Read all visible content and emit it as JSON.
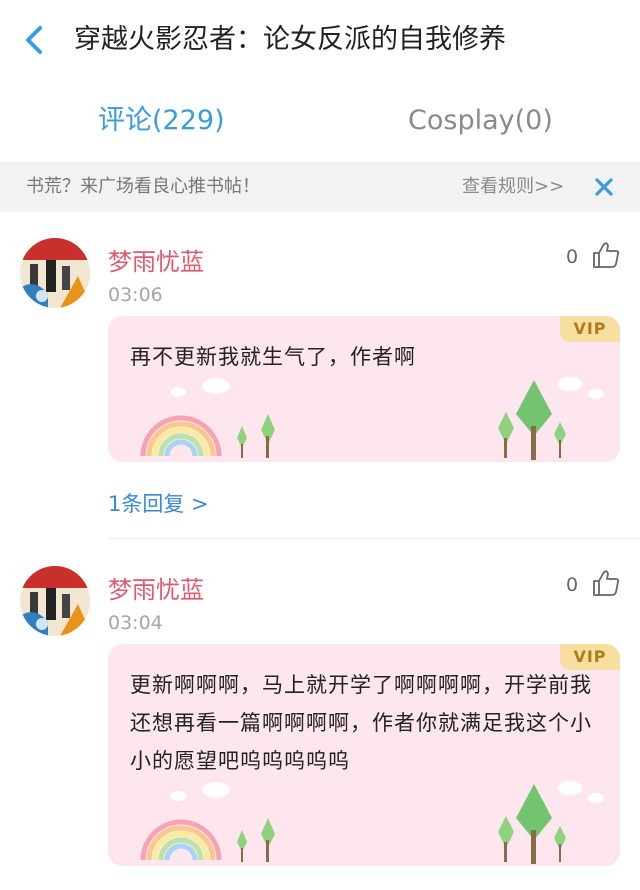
{
  "header": {
    "back_icon": "chevron-left-icon",
    "title": "穿越火影忍者：论女反派的自我修养",
    "accent_color": "#3a9be0"
  },
  "tabs": [
    {
      "label": "评论(229)",
      "active": true
    },
    {
      "label": "Cosplay(0)",
      "active": false
    }
  ],
  "banner": {
    "text": "书荒？来广场看良心推书帖！",
    "link": "查看规则>>",
    "close_icon": "close-icon"
  },
  "comments": [
    {
      "username": "梦雨忧蓝",
      "time": "03:06",
      "likes": "0",
      "badge": "VIP",
      "text": "再不更新我就生气了，作者啊",
      "reply_link": "1条回复 >"
    },
    {
      "username": "梦雨忧蓝",
      "time": "03:04",
      "likes": "0",
      "badge": "VIP",
      "text": "更新啊啊啊，马上就开学了啊啊啊啊，开学前我还想再看一篇啊啊啊啊，作者你就满足我这个小小的愿望吧呜呜呜呜呜"
    }
  ],
  "colors": {
    "username": "#e05a6e",
    "bubble_bg": "#fde6ee",
    "vip_bg": "#f6dfa0",
    "reply_link": "#3a8ad6"
  }
}
